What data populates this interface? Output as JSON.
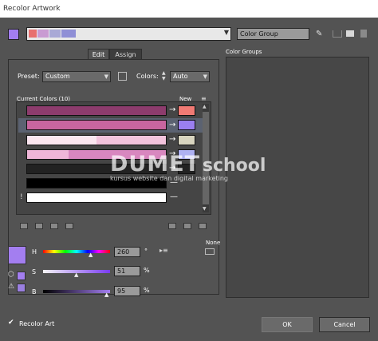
{
  "window": {
    "title": "Recolor Artwork"
  },
  "top": {
    "group_name_value": "Color Group",
    "strip_colors": [
      "#e8706f",
      "#c99bd2",
      "#a9a9d6",
      "#8f8fd6"
    ]
  },
  "tabs": [
    {
      "label": "Edit"
    },
    {
      "label": "Assign"
    }
  ],
  "preset": {
    "label": "Preset:",
    "value": "Custom"
  },
  "colors": {
    "label": "Colors:",
    "value": "Auto"
  },
  "current_colors": {
    "header": "Current Colors (10)",
    "new_header": "New",
    "rows": [
      {
        "current": "#8d3c6d",
        "new": "#f07a74",
        "selected": false
      },
      {
        "current": "#c8659f",
        "new": "#9a7ff0",
        "selected": true
      },
      {
        "current": "#f6d4e6",
        "new": "#d8d4bf",
        "selected": false
      },
      {
        "current": "#d887bf",
        "new": "#aeb1f2",
        "selected": false
      },
      {
        "current": "#222222",
        "new": "#222222",
        "selected": false
      },
      {
        "current": "#000000",
        "new": "#000000",
        "selected": false
      },
      {
        "current": "#ffffff",
        "new": "#ffffff",
        "selected": false
      }
    ]
  },
  "sliders": {
    "active_color": "#a37ef0",
    "h": {
      "label": "H",
      "value": "260",
      "unit": "°"
    },
    "s": {
      "label": "S",
      "value": "51",
      "unit": "%"
    },
    "b": {
      "label": "B",
      "value": "95",
      "unit": "%"
    },
    "none_label": "None"
  },
  "color_groups": {
    "label": "Color Groups"
  },
  "footer": {
    "recolor_art_label": "Recolor Art",
    "recolor_art_checked": true,
    "ok_label": "OK",
    "cancel_label": "Cancel"
  },
  "watermark": {
    "brand": "DUMET",
    "brand2": "school",
    "tagline": "kursus website dan digital marketing"
  }
}
